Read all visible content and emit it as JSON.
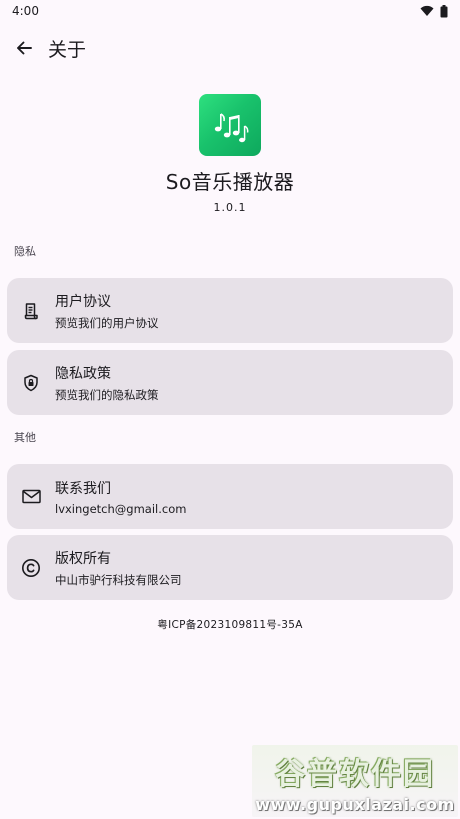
{
  "status_bar": {
    "time": "4:00",
    "icons": [
      "wifi-icon",
      "battery-icon"
    ]
  },
  "top_bar": {
    "title": "关于",
    "back_icon": "arrow-left-icon"
  },
  "app": {
    "name": "So音乐播放器",
    "version": "1.0.1",
    "icon": "music-notes-icon",
    "accent": "#1dc46e"
  },
  "sections": {
    "privacy": {
      "label": "隐私",
      "items": [
        {
          "icon": "document-icon",
          "title": "用户协议",
          "subtitle": "预览我们的用户协议"
        },
        {
          "icon": "shield-lock-icon",
          "title": "隐私政策",
          "subtitle": "预览我们的隐私政策"
        }
      ]
    },
    "other": {
      "label": "其他",
      "items": [
        {
          "icon": "mail-icon",
          "title": "联系我们",
          "subtitle": "lvxingetch@gmail.com"
        },
        {
          "icon": "copyright-icon",
          "title": "版权所有",
          "subtitle": "中山市驴行科技有限公司"
        }
      ]
    }
  },
  "footer": {
    "icp": "粤ICP备2023109811号-35A"
  },
  "watermark": {
    "logo_text": "谷普软件园",
    "url": "www.gupuxlazai.com"
  },
  "colors": {
    "background": "#fdf8fd",
    "card": "#e7e1e8",
    "text": "#1c1b1f"
  }
}
